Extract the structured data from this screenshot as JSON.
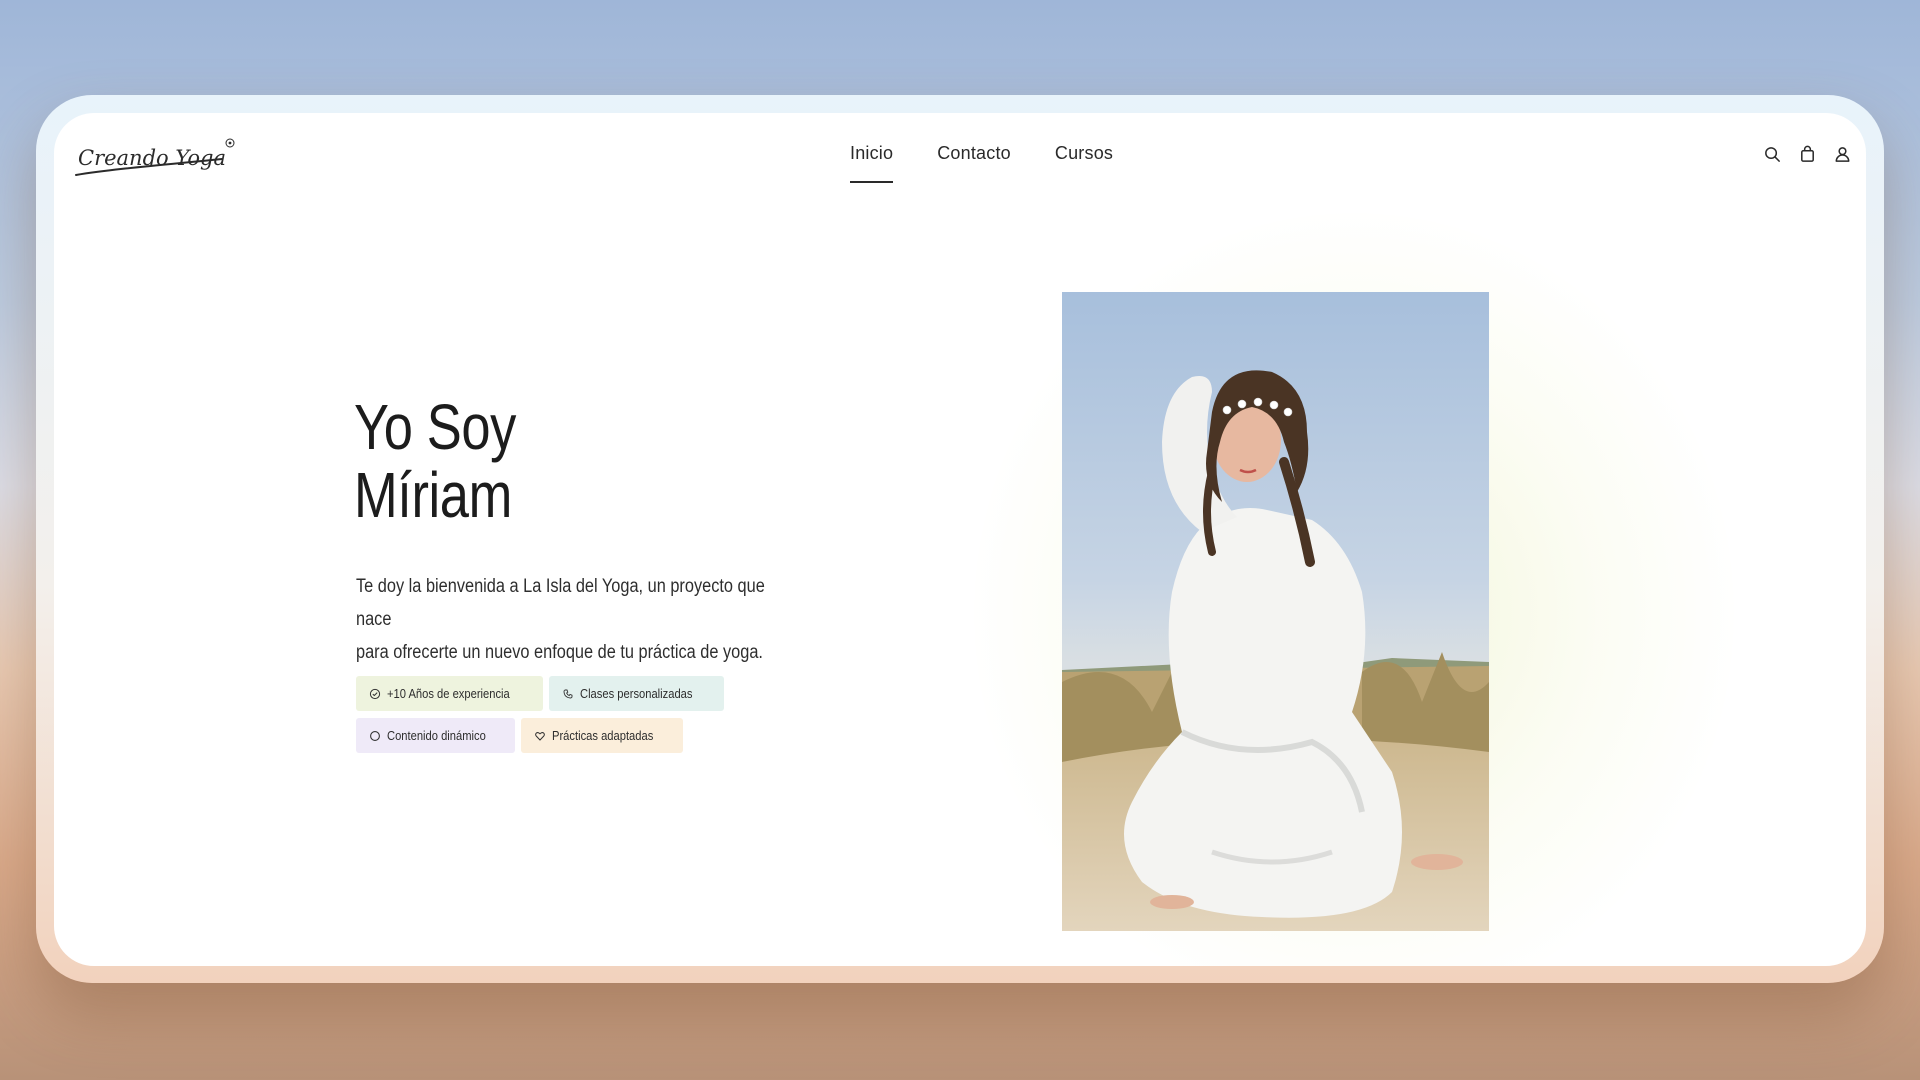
{
  "brand": {
    "logo_text": "Creando Yoga"
  },
  "nav": {
    "items": [
      {
        "label": "Inicio",
        "active": true
      },
      {
        "label": "Contacto",
        "active": false
      },
      {
        "label": "Cursos",
        "active": false
      }
    ]
  },
  "header_icons": [
    "search-icon",
    "bag-icon",
    "user-icon"
  ],
  "hero": {
    "title_line1": "Yo Soy",
    "title_line2": "Míriam",
    "intro_line1": "Te doy la bienvenida a La Isla del Yoga, un proyecto que nace",
    "intro_line2": "para ofrecerte un nuevo enfoque de tu práctica de yoga.",
    "tags": [
      {
        "label": "+10 Años de experiencia",
        "icon": "check-circle-icon",
        "color": "#eef3de"
      },
      {
        "label": "Clases personalizadas",
        "icon": "phone-icon",
        "color": "#e3f1ee"
      },
      {
        "label": "Contenido dinámico",
        "icon": "circle-icon",
        "color": "#efeaf8"
      },
      {
        "label": "Prácticas adaptadas",
        "icon": "heart-icon",
        "color": "#fbeedb"
      }
    ]
  },
  "photo": {
    "subject": "woman-in-white-yoga-pose-on-beach"
  }
}
